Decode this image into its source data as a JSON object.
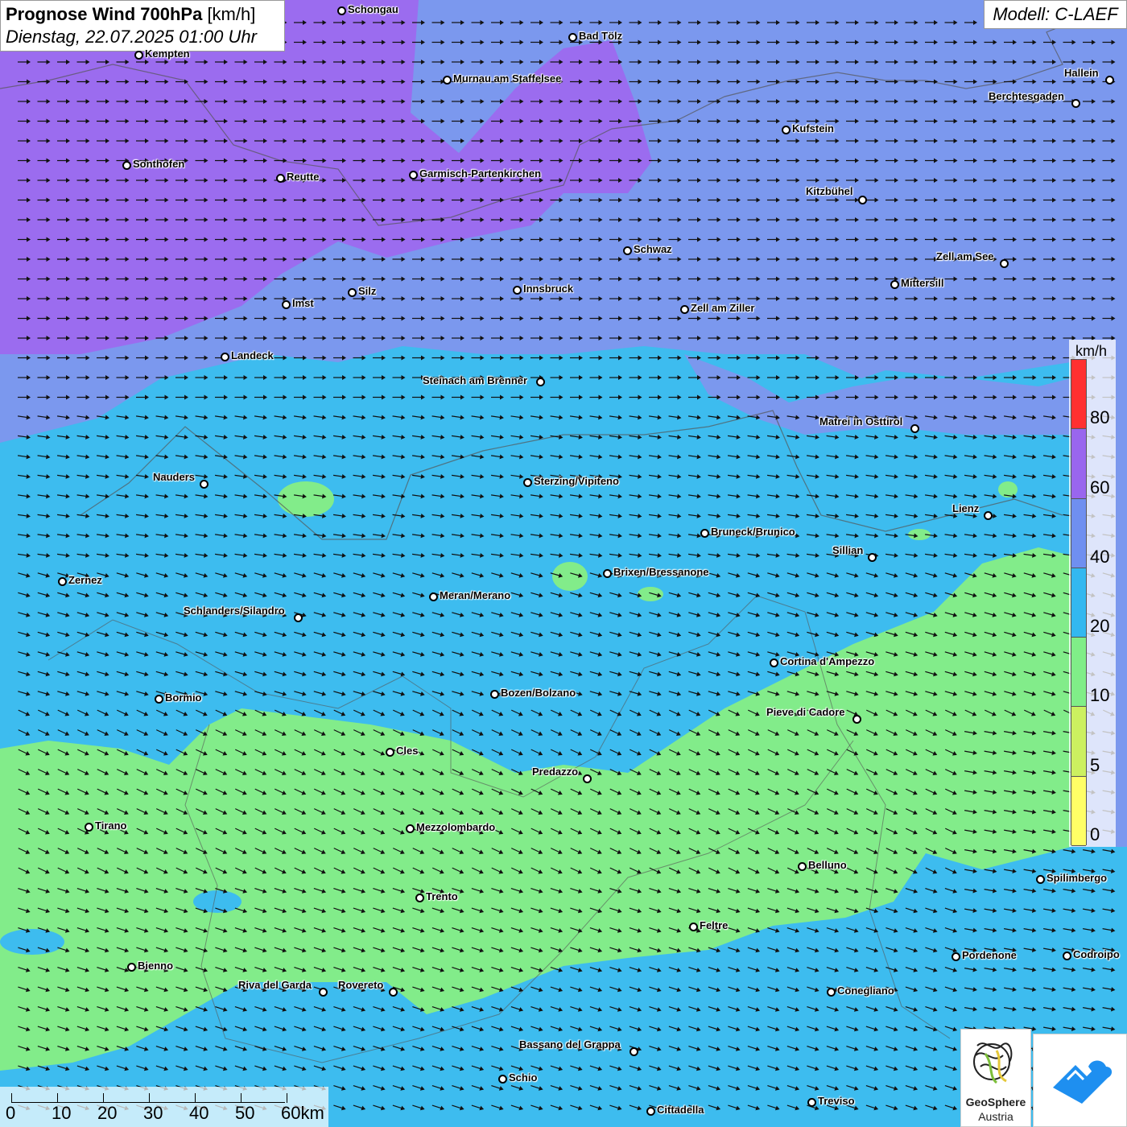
{
  "title": {
    "bold": "Prognose Wind 700hPa",
    "unit": "[km/h]",
    "date": "Dienstag, 22.07.2025 01:00 Uhr"
  },
  "model": "Modell: C-LAEF",
  "legend": {
    "unit": "km/h",
    "colors": [
      "#ff3030",
      "#9966ee",
      "#6f8ff0",
      "#33b8f0",
      "#80ee88",
      "#ccf060",
      "#ffff66"
    ],
    "ticks": [
      "80",
      "60",
      "40",
      "20",
      "10",
      "5",
      "0"
    ]
  },
  "scale": {
    "labels": [
      "0",
      "10",
      "20",
      "30",
      "40",
      "50",
      "60km"
    ]
  },
  "logo": {
    "name": "GeoSphere",
    "country": "Austria"
  },
  "cities": [
    {
      "name": "Schongau",
      "label_side": "right"
    },
    {
      "name": "Bad Tölz",
      "label_side": "right"
    },
    {
      "name": "Kempten",
      "label_side": "right"
    },
    {
      "name": "Murnau am Staffelsee",
      "label_side": "right"
    },
    {
      "name": "Hallein",
      "label_side": "left"
    },
    {
      "name": "Berchtesgaden",
      "label_side": "left"
    },
    {
      "name": "Kufstein",
      "label_side": "right"
    },
    {
      "name": "Sonthofen",
      "label_side": "right"
    },
    {
      "name": "Reutte",
      "label_side": "right"
    },
    {
      "name": "Garmisch-Partenkirchen",
      "label_side": "right"
    },
    {
      "name": "Kitzbühel",
      "label_side": "left"
    },
    {
      "name": "Schwaz",
      "label_side": "right"
    },
    {
      "name": "Zell am See",
      "label_side": "left"
    },
    {
      "name": "Innsbruck",
      "label_side": "right"
    },
    {
      "name": "Mittersill",
      "label_side": "right"
    },
    {
      "name": "Silz",
      "label_side": "right"
    },
    {
      "name": "Imst",
      "label_side": "right"
    },
    {
      "name": "Zell am Ziller",
      "label_side": "right"
    },
    {
      "name": "Landeck",
      "label_side": "right"
    },
    {
      "name": "Steinach am Brenner",
      "label_side": "left"
    },
    {
      "name": "Matrei in Osttirol",
      "label_side": "left"
    },
    {
      "name": "Nauders",
      "label_side": "left"
    },
    {
      "name": "Sterzing/Vipiteno",
      "label_side": "right"
    },
    {
      "name": "Lienz",
      "label_side": "left"
    },
    {
      "name": "Bruneck/Brunico",
      "label_side": "right"
    },
    {
      "name": "Sillian",
      "label_side": "left"
    },
    {
      "name": "Brixen/Bressanone",
      "label_side": "right"
    },
    {
      "name": "Zernez",
      "label_side": "right"
    },
    {
      "name": "Meran/Merano",
      "label_side": "right"
    },
    {
      "name": "Schlanders/Silandro",
      "label_side": "left"
    },
    {
      "name": "Cortina d'Ampezzo",
      "label_side": "right"
    },
    {
      "name": "Bozen/Bolzano",
      "label_side": "right"
    },
    {
      "name": "Bormio",
      "label_side": "right"
    },
    {
      "name": "Pieve di Cadore",
      "label_side": "left"
    },
    {
      "name": "Cles",
      "label_side": "right"
    },
    {
      "name": "Predazzo",
      "label_side": "left"
    },
    {
      "name": "Tirano",
      "label_side": "right"
    },
    {
      "name": "Mezzolombardo",
      "label_side": "right"
    },
    {
      "name": "Belluno",
      "label_side": "right"
    },
    {
      "name": "Spilimbergo",
      "label_side": "right"
    },
    {
      "name": "Trento",
      "label_side": "right"
    },
    {
      "name": "Feltre",
      "label_side": "right"
    },
    {
      "name": "Pordenone",
      "label_side": "right"
    },
    {
      "name": "Codroipo",
      "label_side": "right"
    },
    {
      "name": "Bienno",
      "label_side": "right"
    },
    {
      "name": "Riva del Garda",
      "label_side": "left"
    },
    {
      "name": "Rovereto",
      "label_side": "left"
    },
    {
      "name": "Conegliano",
      "label_side": "right"
    },
    {
      "name": "Bassano del Grappa",
      "label_side": "left"
    },
    {
      "name": "Schio",
      "label_side": "right"
    },
    {
      "name": "Treviso",
      "label_side": "right"
    },
    {
      "name": "Cittadella",
      "label_side": "right"
    }
  ]
}
